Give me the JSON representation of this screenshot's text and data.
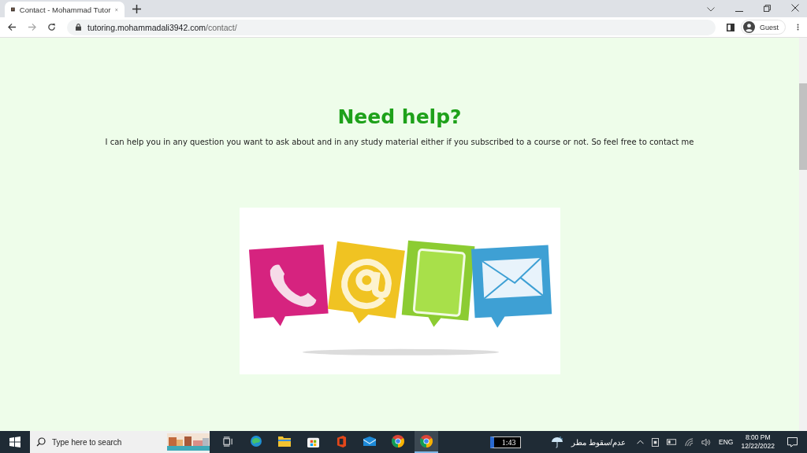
{
  "browser": {
    "tab_title": "Contact - Mohammad Tutor",
    "url_host": "tutoring.mohammadali3942.com",
    "url_path": "/contact/",
    "profile": "Guest"
  },
  "page": {
    "heading": "Need help?",
    "text": "I can help you in any question you want to ask about and in any study material either if you subscribed to a course or not. So feel free to contact me"
  },
  "taskbar": {
    "search_placeholder": "Type here to search",
    "apps": [
      {
        "kind": "taskview",
        "selected": false
      },
      {
        "kind": "edge",
        "selected": false
      },
      {
        "kind": "files",
        "selected": false
      },
      {
        "kind": "store",
        "selected": false
      },
      {
        "kind": "office",
        "selected": false
      },
      {
        "kind": "mail",
        "selected": false
      },
      {
        "kind": "chrome",
        "selected": false
      },
      {
        "kind": "chrome",
        "selected": true
      }
    ],
    "battery": "1:43",
    "weather": "عدم/سقوط مطر",
    "language": "ENG",
    "time": "8:00 PM",
    "date": "12/22/2022"
  }
}
